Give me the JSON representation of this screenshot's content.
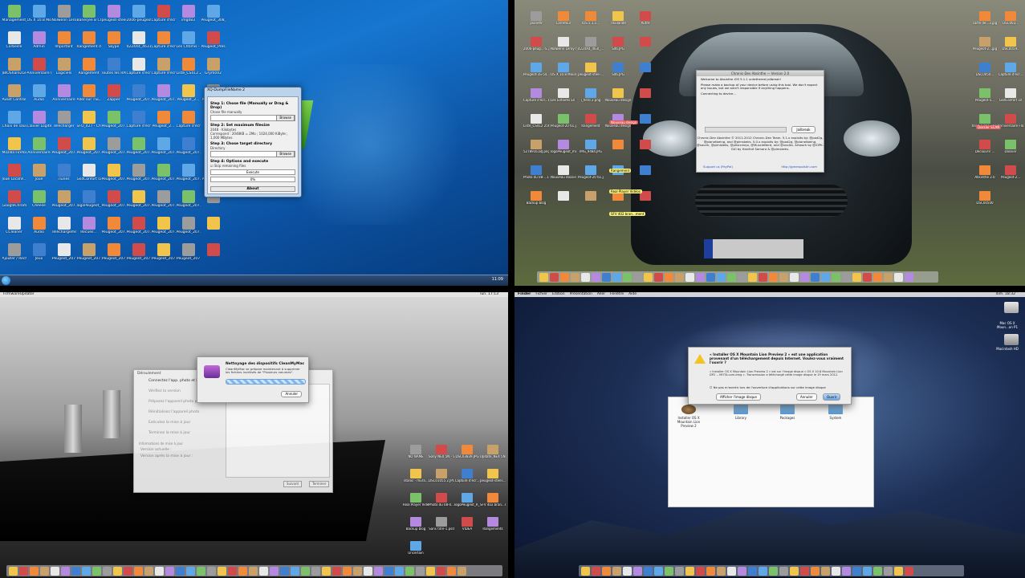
{
  "q1": {
    "icons": [
      "Management_...",
      "OS X 10.8 Mountain Li...",
      "Nolwenn Leroy - Suivre une étoile",
      "Banerjee B CO",
      "peugeot-steel-...",
      "2006-peugeot-...",
      "Capture d'écran 2012-04-23 à...",
      "img083",
      "Peugeot_308_022",
      "Corbeille",
      "Admin",
      "Important",
      "Rangement de fichiers microso...",
      "Skype",
      "4224X4_4631...",
      "Capture d'écran 2012-04-23 à...",
      "Les Chtimis - Chtime ce se...",
      "Peugeot_Presse",
      "JBIOShare2Lel",
      "Anniversaire Florian",
      "Logiciels",
      "Rangement",
      "Toutes les RAB",
      "Capture d'écran 2012-04-23 à...",
      "Capture d'écran 2012-04-23 à...",
      "Liste_CS412 2501_1377",
      "GrymoV2",
      "Avast Control Center",
      "Audio",
      "Anniversaire",
      "Aller sur TSL...",
      "Zapper",
      "Peugeot_207...",
      "Peugeot_207...",
      "Peugeot_2...",
      "Peugeot_2...",
      "Choix de sauvegarde",
      "Clavier Logitech",
      "Télécharger",
      "SFO_427 - Chaplin",
      "Peugeot_207...",
      "Capture d'écran 2012-04-23 à...",
      "Peugeot_2...",
      "Capture d'écran",
      "",
      "Mozilla Firefox",
      "Anniversaire",
      "Peugeot_207...",
      "Peugeot_207...",
      "Peugeot_207...",
      "Peugeot_207...",
      "Peugeot_207...",
      "Peugeot_207...",
      "",
      "Joue LocalVi...",
      "Joue",
      "iTunes",
      "GsdConfort LV",
      "Peugeot_207...",
      "Peugeot_207...",
      "Peugeot_207...",
      "Peugeot_207...",
      "Peugeot_2...",
      "GoogleChrome",
      "Cheese",
      "Peugeot_207...",
      "logoPeugeot_R...",
      "Peugeot_207...",
      "Peugeot_207...",
      "Peugeot_207...",
      "Peugeot_207...",
      "",
      "CCleaner",
      "Audio",
      "Téléchargement",
      "Recueil...",
      "Peugeot_207...",
      "Peugeot_207...",
      "Peugeot_207...",
      "Peugeot_207...",
      "",
      "Ajouter / Rechercher",
      "Jeux",
      "Peugeot_207",
      "Peugeot_207",
      "Peugeot_207",
      "Peugeot_207",
      "Peugeot_207",
      "Peugeot_207",
      ""
    ],
    "window": {
      "title": "XQ-DumpFileName 2",
      "step1": "Step 1: Chose file (Manually or Drag & Drop)",
      "step1_placeholder": "Chose file manually",
      "browse": "Browse",
      "step2": "Step 2: Set maximum filesize",
      "size_value": "2048",
      "unit": "Kilobytes",
      "calc": "Correspond : 2048KB = 2Mo ; 1024,000 KiByte ; 1,000 MBytes",
      "step3": "Step 3: Chose target directory",
      "dir_placeholder": "Directory",
      "browse2": "Browse",
      "step4": "Step 4: Options and execute",
      "option": "Skip remaining files",
      "execute": "Execute",
      "progress": "0%",
      "about": "About"
    },
    "clock": "11:09"
  },
  "q2": {
    "absinthe": {
      "title": "Chronic-Dev Absinthe — Version 2.0",
      "welcome": "Welcome to Absinthe iOS 5.1.1 untethered jailbreak!",
      "warning": "Please make a backup of your device before using this tool. We don't expect any issues, but we aren't responsible if anything happens.",
      "status": "Connecting to device...",
      "button": "Jailbreak",
      "credits": "Chronic-Dev Absinthe © 2011-2012 Chronic-Dev Team. 5.1.x exploits by: @pod2g, @planetbeing, and @pimskeks. 5.0.x exploits by: @pod2g, @planetbeing, @saurik, @pimskeks, @p0sixninja, @MuscleNerd, and @xvolks. Artwork by @iOPK. GUI by Hanèné Samara & @pimskeks.",
      "support": "Support us (PayPal)",
      "link": "http://greenpois0n.com"
    },
    "left_icons": [
      "planet9",
      "Carrefour",
      "iOS 5.1.1...",
      "Thaïlande",
      "Autre",
      "2006-peug...-S.jpg",
      "Nolwenn Leroy-Suivre",
      "4224X4_463I_...JPG",
      "S46.JPG",
      "",
      "Peugeot-3S-54...7.jpg",
      "OS X 10.8 Mountain Li...",
      "peugeot-stee-...",
      "S46.JPG",
      "",
      "Capture d'écr...8.11",
      "Les Enfoirés En Live",
      "i_hero 2.png",
      "Nouveau design",
      "",
      "Liste_CS412 2561..1577",
      "Peugeot-20 61.jpg",
      "Rangement",
      "Nouveau design",
      "",
      "527891618J.png",
      "logoPeugeot_mot...0.jpg",
      "IMG_9484.JPG",
      "",
      "",
      "Photo du 08-...1.2",
      "Nouveau dossier",
      "Peugeot-20 61.jpg",
      "",
      "",
      "Backup blog",
      "",
      "",
      "",
      ""
    ],
    "right_icons": [
      "carte de...3.jpg",
      "DSC003...",
      "Peugeot-2...jpg",
      "DSC0059..",
      "DSC0050...",
      "Capture d'écr...",
      "Peugeot-5...",
      "GsdConfort LV",
      "Ilave Ligne - Live",
      "Anniversaire Florian",
      "Découvrir ...",
      "Dossier",
      "Absinthe 2.0",
      "Peugeot-2...",
      "DSC00500"
    ],
    "tags": [
      "Rangement",
      "Real Player Vidéos",
      "SFV 402 bran...ment",
      "Nouveau design"
    ],
    "red_tag": "Dossier SCAN"
  },
  "q3": {
    "menubar": [
      "FirmwareUpdater"
    ],
    "menubar_right": "lun. 17:13",
    "window": {
      "header": "Déroulement",
      "steps": [
        "Connectez l'app. photo et l'o...",
        "Vérifiez la version",
        "Préparez l'appareil photo pour la mise à jour",
        "Réinitialisez l'appareil photo",
        "Exécutez la mise à jour",
        "Terminez la mise à jour"
      ],
      "info_title": "Informations de mise à jour",
      "current": "Version actuelle :",
      "after": "Version après la mise à jour :",
      "next": "Suivant",
      "finish": "Terminer"
    },
    "cmm": {
      "title": "Nettoyage des dispositifs CleanMyMac",
      "desc": "CleanMyMac se prépare maintenant à supprimer les fichiers inutilisés de \"Plusieurs volumes\".",
      "cancel": "Annuler"
    },
    "icons": [
      "NO NAME",
      "Sony NEX 5N - Vid...ot.fst",
      "DSC03839.JPG",
      "Update_NEX 5N V101",
      "Titanic - mura...a.jpg",
      "DSC01055 2.JPG",
      "Capture d'écr...",
      "peugeot-steel...a.jpg",
      "Real Player Vidéos",
      "Photo du 08-0...5.12",
      "logoPeugeot_R_RVB.png",
      "SFV 402 bran...ment",
      "Backup blog",
      "Sans titre-1.psd",
      "VIDEA",
      "Rangements",
      "Uncertain"
    ]
  },
  "q4": {
    "menubar": [
      "Finder",
      "Fichier",
      "Édition",
      "Présentation",
      "Aller",
      "Fenêtre",
      "Aide"
    ],
    "menubar_right": "dim. 18:32",
    "alert": {
      "title": "« Installer OS X Mountain Lion Preview 2 » est une application provenant d'un téléchargement depuis Internet. Voulez-vous vraiment l'ouvrir ?",
      "detail": "« Installer OS X Mountain Lion Preview 2 » est sur l'image disque « OS X 10.8 Mountain Lion DP2 -- MOTA.com.dmg ». Transmission a téléchargé cette image disque le 19 mars 2012.",
      "checkbox": "Ne pas m'avertir lors de l'ouverture d'applications sur cette image disque",
      "show": "Afficher l'image disque",
      "cancel": "Annuler",
      "open": "Ouvrir"
    },
    "finder_items": [
      "Installer OS X Mountain Lion Preview 2",
      "Library",
      "Packages",
      "System"
    ],
    "hd_icons": [
      "Mac OS X Moun...on P1",
      "Macintosh HD"
    ]
  }
}
